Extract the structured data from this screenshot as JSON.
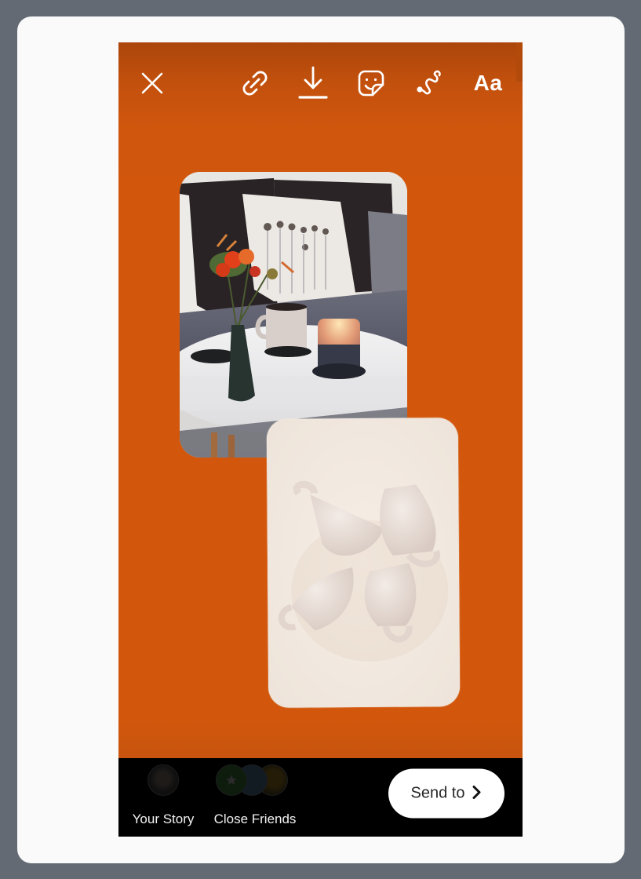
{
  "app": {
    "screen": "Story editor"
  },
  "colors": {
    "background": "#d2570d",
    "frame": "#636a74",
    "card": "#fafafa",
    "bottom_bar": "#000000",
    "send_button": "#ffffff",
    "send_text": "#262626"
  },
  "toolbar": {
    "close_icon": "close-icon",
    "link_icon": "link-icon",
    "download_icon": "download-icon",
    "sticker_icon": "sticker-icon",
    "draw_icon": "draw-icon",
    "text_label": "Aa"
  },
  "canvas": {
    "photos": [
      {
        "description": "Living room coffee table with flowers in green vase, mug and lit candle"
      },
      {
        "description": "Stack of handmade white ceramic cups on marble surface"
      }
    ]
  },
  "bottom": {
    "your_story_label": "Your Story",
    "close_friends_label": "Close Friends",
    "send_label": "Send to",
    "send_icon": "chevron-right-icon"
  }
}
